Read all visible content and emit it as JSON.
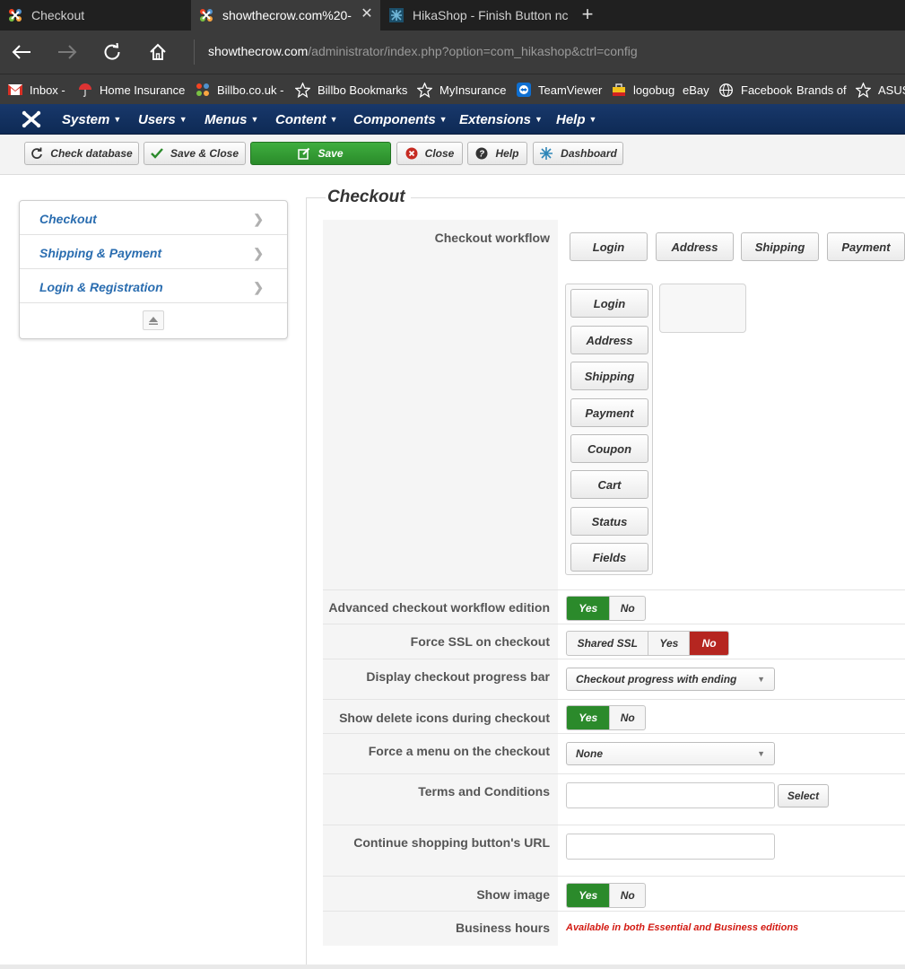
{
  "browser": {
    "tabs": [
      {
        "title": "Checkout",
        "icon": "joomla-icon"
      },
      {
        "title": "showthecrow.com%20-",
        "icon": "joomla-icon"
      },
      {
        "title": "HikaShop - Finish Button nc",
        "icon": "hikashop-icon"
      }
    ],
    "close_glyph": "✕",
    "newtab_glyph": "+",
    "url_host": "showthecrow.com",
    "url_path": "/administrator/index.php?option=com_hikashop&ctrl=config",
    "bookmarks": [
      {
        "label": "Inbox -",
        "icon": "gmail-icon"
      },
      {
        "label": "Home Insurance",
        "icon": "umbrella-icon"
      },
      {
        "label": "Billbo.co.uk -",
        "icon": "joomla-icon"
      },
      {
        "label": "Billbo Bookmarks",
        "icon": "star-icon"
      },
      {
        "label": "MyInsurance",
        "icon": "star-icon"
      },
      {
        "label": "TeamViewer",
        "icon": "teamviewer-icon"
      },
      {
        "label": "logobug",
        "icon": "bag-icon"
      },
      {
        "label": "eBay",
        "icon": "none"
      },
      {
        "label": "Facebook",
        "icon": "globe-icon"
      },
      {
        "label": "Brands of",
        "icon": "none"
      },
      {
        "label": "ASUS",
        "icon": "star-icon"
      }
    ]
  },
  "admin_menu": [
    "System",
    "Users",
    "Menus",
    "Content",
    "Components",
    "Extensions",
    "Help"
  ],
  "toolbar": {
    "check_database": "Check database",
    "save_close": "Save & Close",
    "save": "Save",
    "close": "Close",
    "help": "Help",
    "dashboard": "Dashboard"
  },
  "sidenav": [
    "Checkout",
    "Shipping & Payment",
    "Login & Registration"
  ],
  "section_title": "Checkout",
  "workflow": {
    "label": "Checkout workflow",
    "top_steps": [
      "Login",
      "Address",
      "Shipping",
      "Payment"
    ],
    "available_steps": [
      "Login",
      "Address",
      "Shipping",
      "Payment",
      "Coupon",
      "Cart",
      "Status",
      "Fields"
    ]
  },
  "settings": {
    "advanced": {
      "label": "Advanced checkout workflow edition",
      "options": [
        "Yes",
        "No"
      ],
      "selected": "Yes"
    },
    "force_ssl": {
      "label": "Force SSL on checkout",
      "options": [
        "Shared SSL",
        "Yes",
        "No"
      ],
      "selected": "No"
    },
    "progress_bar": {
      "label": "Display checkout progress bar",
      "value": "Checkout progress with ending"
    },
    "delete_icons": {
      "label": "Show delete icons during checkout",
      "options": [
        "Yes",
        "No"
      ],
      "selected": "Yes"
    },
    "force_menu": {
      "label": "Force a menu on the checkout",
      "value": "None"
    },
    "terms": {
      "label": "Terms and Conditions",
      "button": "Select",
      "value": ""
    },
    "continue_url": {
      "label": "Continue shopping button's URL",
      "value": ""
    },
    "show_image": {
      "label": "Show image",
      "options": [
        "Yes",
        "No"
      ],
      "selected": "Yes"
    },
    "business_hours": {
      "label": "Business hours",
      "notice": "Available in both Essential and Business editions"
    }
  },
  "colors": {
    "admin_bar": "#14346a",
    "save_green": "#2b8a2b",
    "yes_green": "#2b8a2b",
    "no_red": "#b52620",
    "link_blue": "#2a6db0",
    "notice_red": "#d31a12"
  }
}
